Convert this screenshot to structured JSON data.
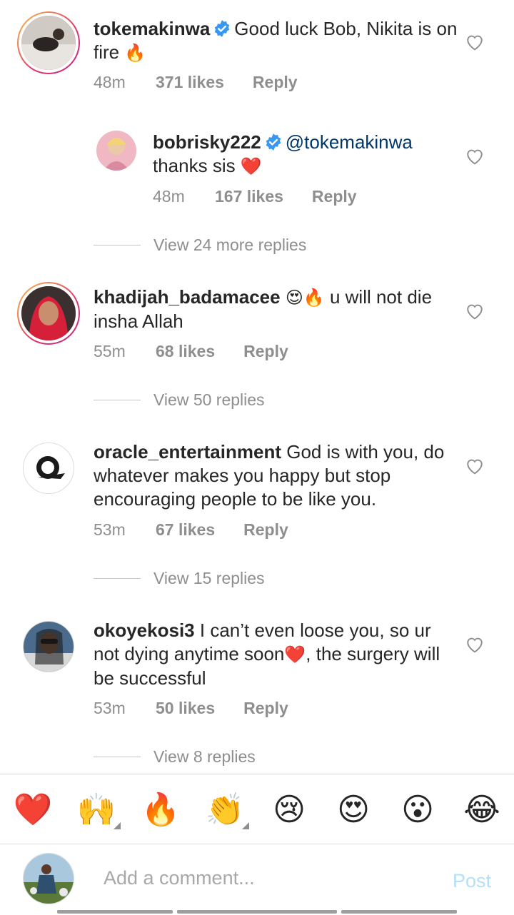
{
  "comments": [
    {
      "username": "tokemakinwa",
      "verified": true,
      "text": "Good luck Bob, Nikita is on fire",
      "emoji_after": "🔥",
      "time": "48m",
      "likes": "371 likes",
      "reply": "Reply"
    },
    {
      "username": "bobrisky222",
      "verified": true,
      "mention": "@tokemakinwa",
      "text": "thanks sis",
      "emoji_after": "❤️",
      "time": "48m",
      "likes": "167 likes",
      "reply": "Reply",
      "is_reply": true
    },
    {
      "username": "khadijah_badamacee",
      "emoji_before": "😍🔥",
      "text": "u will not die insha Allah",
      "time": "55m",
      "likes": "68 likes",
      "reply": "Reply"
    },
    {
      "username": "oracle_entertainment",
      "text": "God is with you, do whatever makes you happy but stop encouraging people to be like you.",
      "time": "53m",
      "likes": "67 likes",
      "reply": "Reply"
    },
    {
      "username": "okoyekosi3",
      "text_part1": "I can’t even loose you, so ur not dying anytime soon",
      "emoji_mid": "❤️",
      "text_part2": ", the surgery will be successful",
      "time": "53m",
      "likes": "50 likes",
      "reply": "Reply"
    }
  ],
  "view_replies": [
    "View 24 more replies",
    "View 50 replies",
    "View 15 replies",
    "View 8 replies"
  ],
  "emoji_bar": [
    {
      "glyph": "❤️",
      "name": "red-heart-emoji"
    },
    {
      "glyph": "🙌",
      "name": "raising-hands-emoji"
    },
    {
      "glyph": "🔥",
      "name": "fire-emoji"
    },
    {
      "glyph": "👏",
      "name": "clapping-hands-emoji"
    },
    {
      "glyph": "😢",
      "name": "crying-face-emoji"
    },
    {
      "glyph": "😍",
      "name": "heart-eyes-emoji"
    },
    {
      "glyph": "😮",
      "name": "surprised-face-emoji"
    },
    {
      "glyph": "😂",
      "name": "tears-of-joy-emoji"
    }
  ],
  "composer": {
    "placeholder": "Add a comment...",
    "post_label": "Post"
  },
  "colors": {
    "verified_blue": "#3897f0",
    "meta_gray": "#8e8e8e",
    "post_disabled": "#b2dffc",
    "mention": "#00376b"
  }
}
